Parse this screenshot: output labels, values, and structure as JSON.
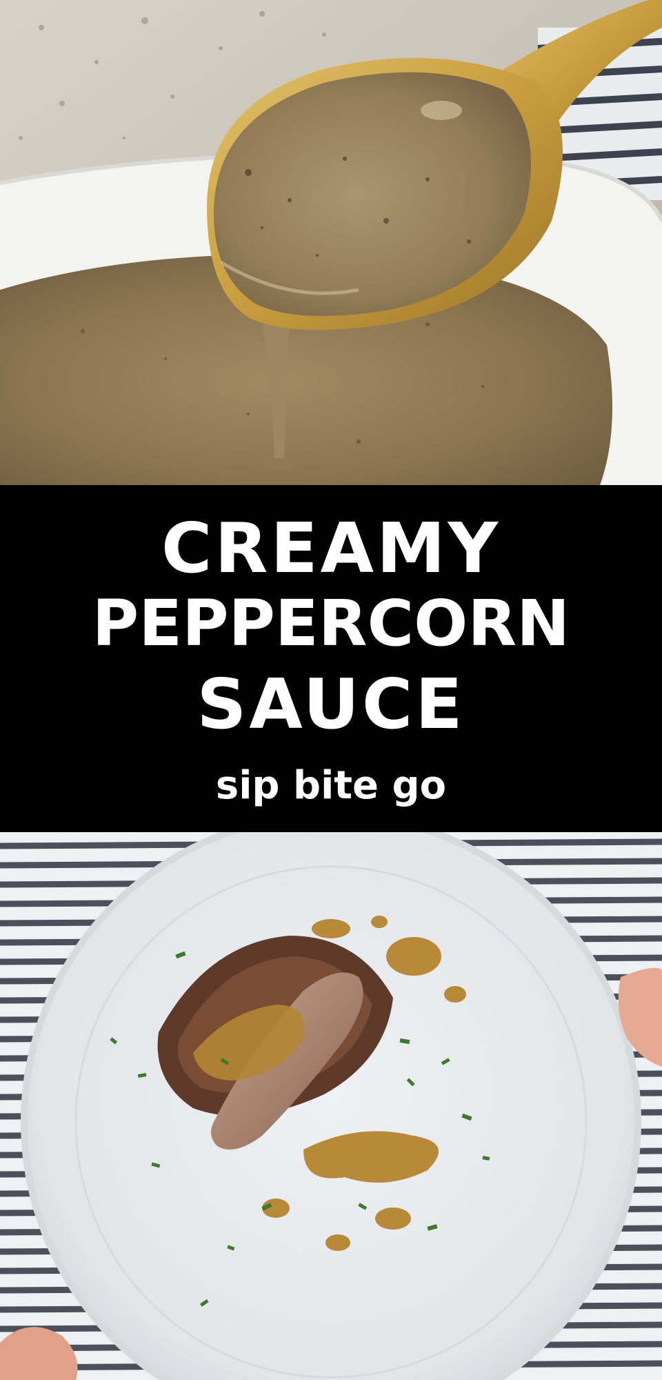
{
  "banner": {
    "title_line_1": "CREAMY",
    "title_line_2": "PEPPERCORN",
    "title_line_3": "SAUCE",
    "brand": "sip bite go"
  },
  "colors": {
    "banner_background": "#000000",
    "banner_text": "#ffffff",
    "sauce": "#8e7a56",
    "spoon_gold": "#c9a24a",
    "plate": "#e9ecee",
    "stripe_dark": "#3a3f4a"
  }
}
